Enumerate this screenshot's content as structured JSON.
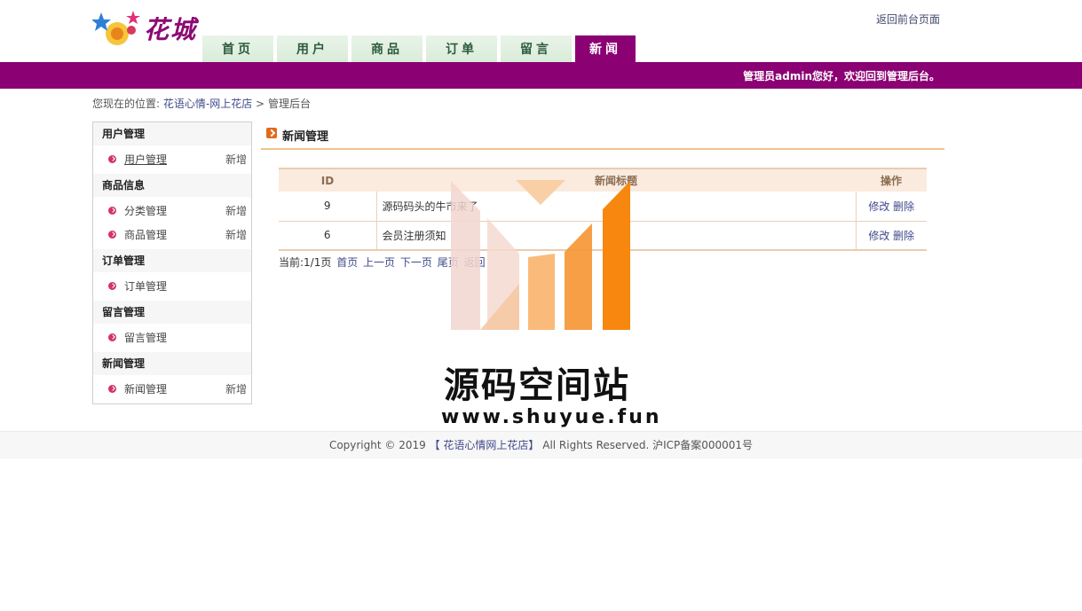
{
  "header": {
    "logo_text": "花城",
    "back_link": "返回前台页面",
    "welcome": "管理员admin您好，欢迎回到管理后台。"
  },
  "nav": {
    "tabs": [
      "首页",
      "用户",
      "商品",
      "订单",
      "留言",
      "新闻"
    ],
    "active": "新闻"
  },
  "breadcrumb": {
    "prefix": "您现在的位置:",
    "shop": "花语心情-网上花店",
    "sep": ">",
    "current": "管理后台"
  },
  "sidebar": {
    "groups": [
      {
        "title": "用户管理",
        "items": [
          {
            "label": "用户管理",
            "add": "新增"
          }
        ]
      },
      {
        "title": "商品信息",
        "items": [
          {
            "label": "分类管理",
            "add": "新增"
          },
          {
            "label": "商品管理",
            "add": "新增"
          }
        ]
      },
      {
        "title": "订单管理",
        "items": [
          {
            "label": "订单管理"
          }
        ]
      },
      {
        "title": "留言管理",
        "items": [
          {
            "label": "留言管理"
          }
        ]
      },
      {
        "title": "新闻管理",
        "items": [
          {
            "label": "新闻管理",
            "add": "新增"
          }
        ]
      }
    ]
  },
  "main": {
    "title": "新闻管理",
    "table": {
      "headers": [
        "ID",
        "新闻标题",
        "操作"
      ],
      "rows": [
        {
          "id": "9",
          "title": "源码码头的牛市来了",
          "edit": "修改",
          "delete": "删除"
        },
        {
          "id": "6",
          "title": "会员注册须知",
          "edit": "修改",
          "delete": "删除"
        }
      ]
    },
    "pager": {
      "status": "当前:1/1页",
      "first": "首页",
      "prev": "上一页",
      "next": "下一页",
      "last": "尾页",
      "go": "返回"
    }
  },
  "watermark": {
    "text": "源码空间站",
    "url": "www.shuyue.fun"
  },
  "footer": {
    "copyright": "Copyright © 2019",
    "shop": "【 花语心情网上花店】",
    "rights": "All Rights Reserved. 沪ICP备案000001号"
  },
  "colors": {
    "brand_purple": "#8b0073",
    "accent_orange": "#f0c38e",
    "link_blue": "#404a8a"
  }
}
